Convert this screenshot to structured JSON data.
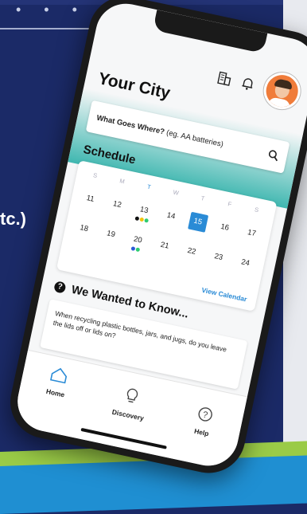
{
  "background": {
    "partial_text": "tc.)"
  },
  "header": {
    "title": "Your City"
  },
  "search": {
    "label": "What Goes Where?",
    "placeholder": "(eg. AA batteries)"
  },
  "schedule": {
    "title": "Schedule",
    "weekdays": [
      "S",
      "M",
      "T",
      "W",
      "T",
      "F",
      "S"
    ],
    "rows": [
      [
        "11",
        "12",
        "13",
        "14",
        "15",
        "16",
        "17"
      ],
      [
        "18",
        "19",
        "20",
        "21",
        "22",
        "23",
        "24"
      ]
    ],
    "selected_day": "15",
    "view_calendar": "View Calendar",
    "colors": {
      "accent": "#2a8bd6",
      "dot_black": "#111111",
      "dot_yellow": "#f1c40f",
      "dot_green": "#2ecc71",
      "dot_blue": "#2a5bd6"
    }
  },
  "we_wanted_to_know": {
    "title": "We Wanted to Know...",
    "question": "When recycling plastic bottles, jars, and jugs, do you leave the lids off or lids on?"
  },
  "nav": {
    "home": "Home",
    "discovery": "Discovery",
    "help": "Help"
  }
}
